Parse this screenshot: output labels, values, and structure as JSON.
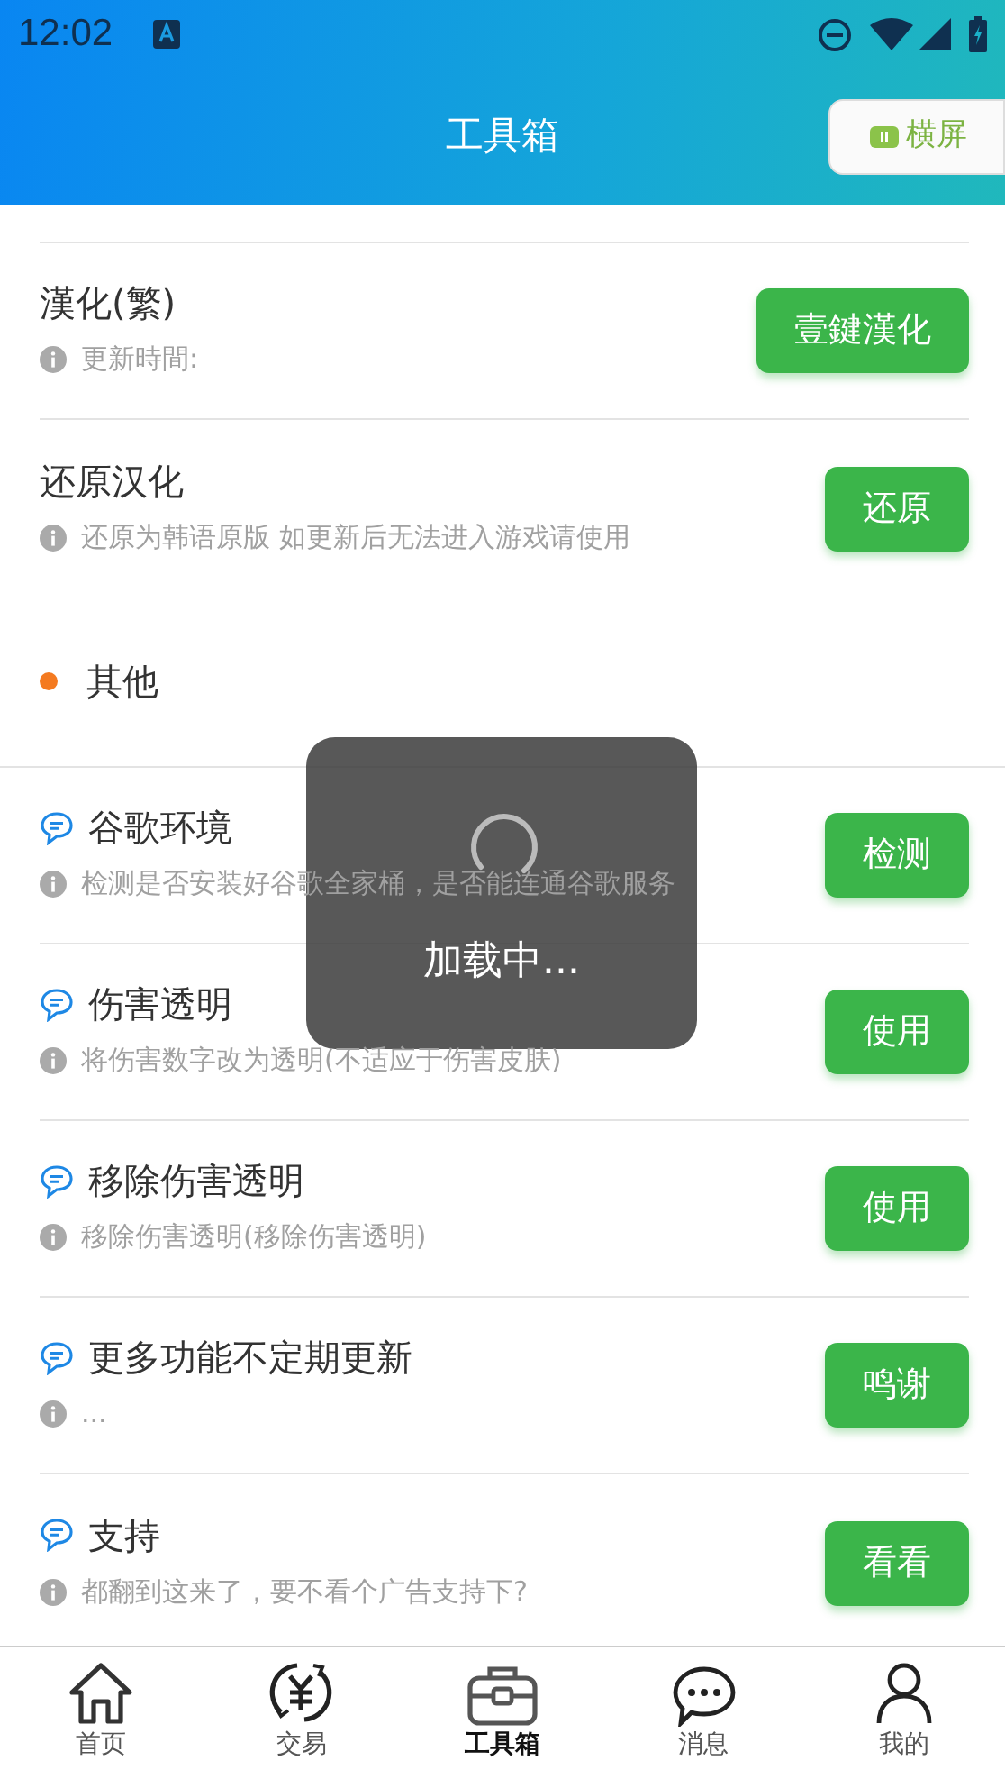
{
  "status_bar": {
    "time": "12:02"
  },
  "header": {
    "title": "工具箱",
    "landscape_button": "横屏"
  },
  "groups": [
    {
      "items": [
        {
          "kind": "plain",
          "title": "漢化(繁)",
          "note": "更新時間:",
          "button": "壹鍵漢化"
        },
        {
          "kind": "plain",
          "title": "还原汉化",
          "note": "还原为韩语原版 如更新后无法进入游戏请使用",
          "button": "还原"
        }
      ]
    },
    {
      "heading": "其他",
      "items": [
        {
          "kind": "chat",
          "title": "谷歌环境",
          "note": "检测是否安装好谷歌全家桶，是否能连通谷歌服务",
          "button": "检测"
        },
        {
          "kind": "chat",
          "title": "伤害透明",
          "note": "将伤害数字改为透明(不适应于伤害皮肤)",
          "button": "使用"
        },
        {
          "kind": "chat",
          "title": "移除伤害透明",
          "note": "移除伤害透明(移除伤害透明)",
          "button": "使用"
        },
        {
          "kind": "chat",
          "title": "更多功能不定期更新",
          "note": "...",
          "button": "鸣谢"
        },
        {
          "kind": "chat",
          "title": "支持",
          "note": "都翻到这来了，要不看个广告支持下?",
          "button": "看看"
        }
      ]
    }
  ],
  "toast": {
    "text": "加载中..."
  },
  "nav": [
    {
      "label": "首页",
      "selected": false
    },
    {
      "label": "交易",
      "selected": false
    },
    {
      "label": "工具箱",
      "selected": true
    },
    {
      "label": "消息",
      "selected": false
    },
    {
      "label": "我的",
      "selected": false
    }
  ]
}
